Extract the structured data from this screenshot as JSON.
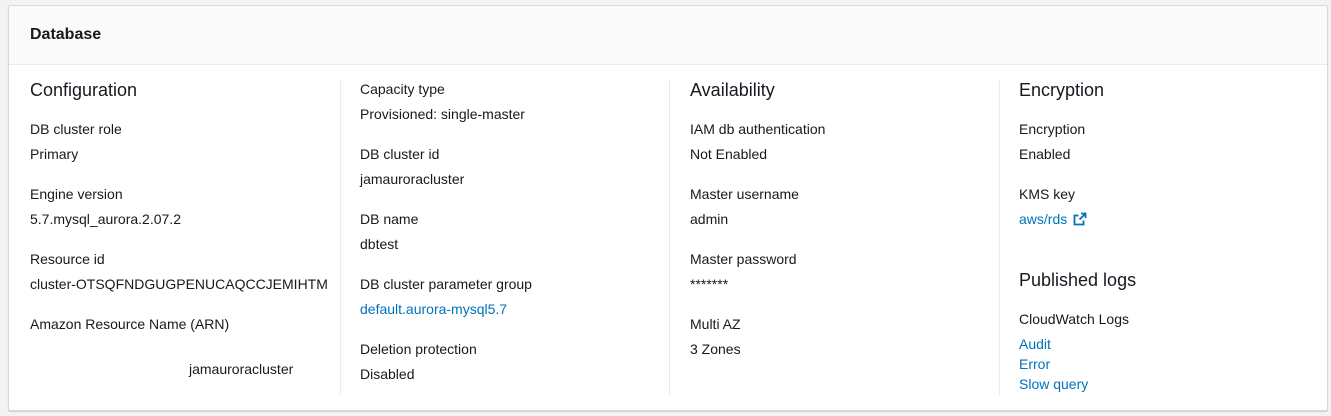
{
  "panel": {
    "title": "Database"
  },
  "configuration": {
    "title": "Configuration",
    "db_cluster_role": {
      "label": "DB cluster role",
      "value": "Primary"
    },
    "engine_version": {
      "label": "Engine version",
      "value": "5.7.mysql_aurora.2.07.2"
    },
    "resource_id": {
      "label": "Resource id",
      "value": "cluster-OTSQFNDGUGPENUCAQCCJEMIHTM"
    },
    "arn": {
      "label": "Amazon Resource Name (ARN)",
      "value": "jamauroracluster"
    }
  },
  "capacity": {
    "capacity_type": {
      "label": "Capacity type",
      "value": "Provisioned: single-master"
    },
    "db_cluster_id": {
      "label": "DB cluster id",
      "value": "jamauroracluster"
    },
    "db_name": {
      "label": "DB name",
      "value": "dbtest"
    },
    "parameter_group": {
      "label": "DB cluster parameter group",
      "value": "default.aurora-mysql5.7"
    },
    "deletion_protection": {
      "label": "Deletion protection",
      "value": "Disabled"
    }
  },
  "availability": {
    "title": "Availability",
    "iam_auth": {
      "label": "IAM db authentication",
      "value": "Not Enabled"
    },
    "master_username": {
      "label": "Master username",
      "value": "admin"
    },
    "master_password": {
      "label": "Master password",
      "value": "*******"
    },
    "multi_az": {
      "label": "Multi AZ",
      "value": "3 Zones"
    }
  },
  "encryption": {
    "title": "Encryption",
    "encryption": {
      "label": "Encryption",
      "value": "Enabled"
    },
    "kms_key": {
      "label": "KMS key",
      "value": "aws/rds",
      "icon": "external-link-icon"
    }
  },
  "published_logs": {
    "title": "Published logs",
    "cloudwatch_label": "CloudWatch Logs",
    "links": [
      "Audit",
      "Error",
      "Slow query"
    ]
  },
  "colors": {
    "link": "#0073bb",
    "text": "#16191f",
    "border": "#d5dbdb"
  }
}
